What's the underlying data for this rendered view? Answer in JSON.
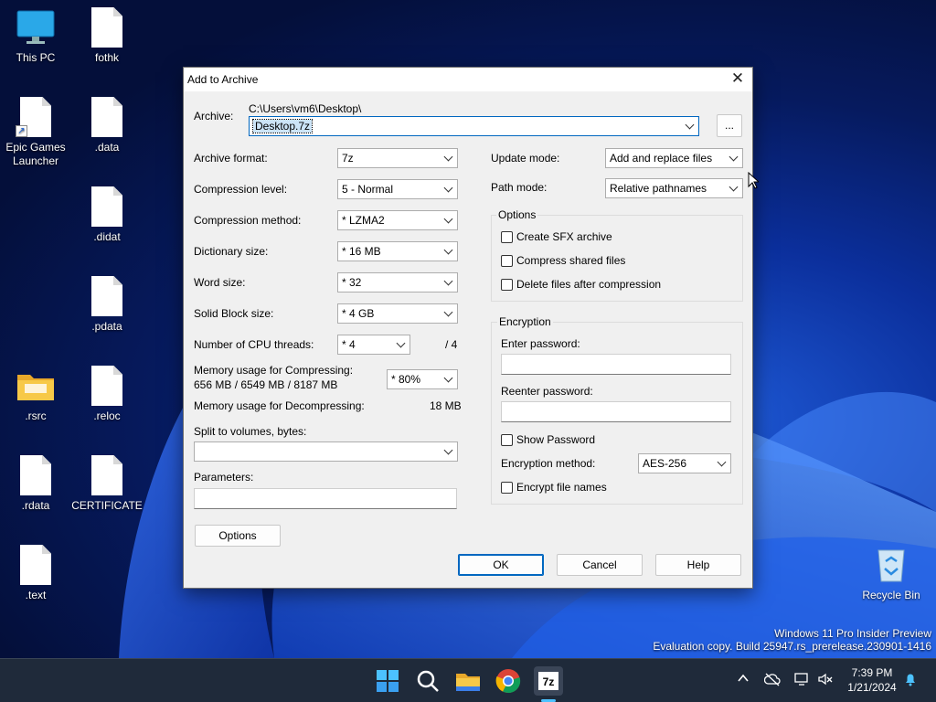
{
  "desktop": {
    "icons": [
      {
        "label": "This PC"
      },
      {
        "label": "fothk"
      },
      {
        "label": "Epic Games Launcher"
      },
      {
        "label": ".data"
      },
      {
        "label": ".didat"
      },
      {
        "label": ".pdata"
      },
      {
        "label": ".rsrc"
      },
      {
        "label": ".reloc"
      },
      {
        "label": ".rdata"
      },
      {
        "label": "CERTIFICATE"
      },
      {
        "label": ".text"
      },
      {
        "label": "Recycle Bin"
      }
    ],
    "watermark_line1": "Windows 11 Pro Insider Preview",
    "watermark_line2": "Evaluation copy. Build 25947.rs_prerelease.230901-1416"
  },
  "dialog": {
    "title": "Add to Archive",
    "archive_label": "Archive:",
    "archive_path": "C:\\Users\\vm6\\Desktop\\",
    "archive_name": "Desktop.7z",
    "browse_label": "...",
    "left": {
      "archive_format_label": "Archive format:",
      "archive_format_value": "7z",
      "compression_level_label": "Compression level:",
      "compression_level_value": "5 - Normal",
      "compression_method_label": "Compression method:",
      "compression_method_value": "*  LZMA2",
      "dictionary_size_label": "Dictionary size:",
      "dictionary_size_value": "*  16 MB",
      "word_size_label": "Word size:",
      "word_size_value": "*  32",
      "solid_block_label": "Solid Block size:",
      "solid_block_value": "*  4 GB",
      "cpu_threads_label": "Number of CPU threads:",
      "cpu_threads_value": "*  4",
      "cpu_threads_max": "/ 4",
      "mem_compress_label": "Memory usage for Compressing:",
      "mem_compress_detail": "656 MB / 6549 MB / 8187 MB",
      "mem_compress_value": "*  80%",
      "mem_decompress_label": "Memory usage for Decompressing:",
      "mem_decompress_value": "18 MB",
      "split_label": "Split to volumes, bytes:",
      "split_value": "",
      "parameters_label": "Parameters:",
      "parameters_value": "",
      "options_button": "Options"
    },
    "right": {
      "update_mode_label": "Update mode:",
      "update_mode_value": "Add and replace files",
      "path_mode_label": "Path mode:",
      "path_mode_value": "Relative pathnames",
      "options_group": "Options",
      "create_sfx": "Create SFX archive",
      "compress_shared": "Compress shared files",
      "delete_after": "Delete files after compression",
      "encryption_group": "Encryption",
      "enter_password_label": "Enter password:",
      "reenter_password_label": "Reenter password:",
      "show_password": "Show Password",
      "encryption_method_label": "Encryption method:",
      "encryption_method_value": "AES-256",
      "encrypt_names": "Encrypt file names"
    },
    "ok_button": "OK",
    "cancel_button": "Cancel",
    "help_button": "Help"
  },
  "taskbar": {
    "time": "7:39 PM",
    "date": "1/21/2024",
    "apps": [
      "start-icon",
      "search-icon",
      "file-explorer-icon",
      "chrome-icon",
      "7zip-icon"
    ]
  },
  "colors": {
    "accent": "#0067c0",
    "selection": "#cce4f7"
  }
}
